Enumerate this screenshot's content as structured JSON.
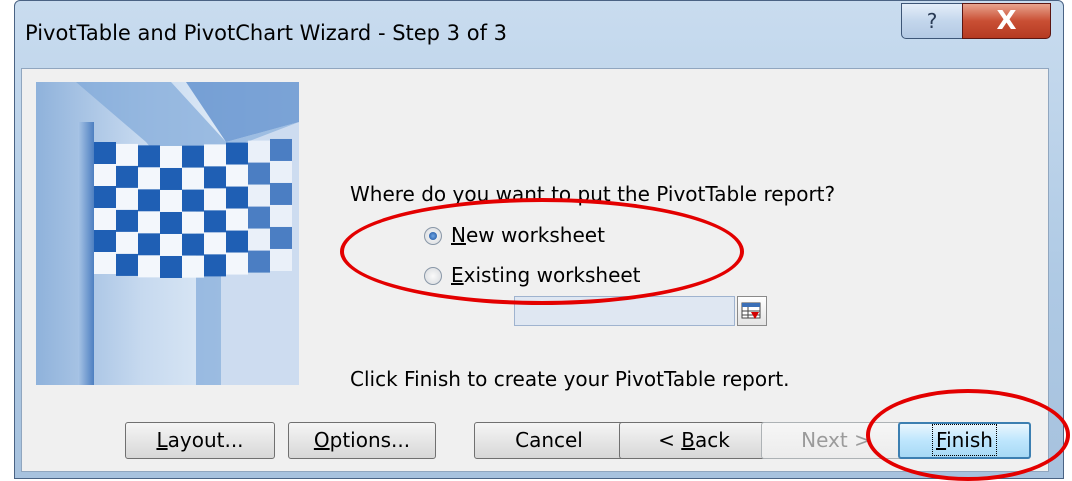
{
  "window": {
    "title": "PivotTable and PivotChart Wizard - Step 3 of 3",
    "help_glyph": "?",
    "close_glyph": "X"
  },
  "content": {
    "question": "Where do you want to put the PivotTable report?",
    "options": [
      {
        "pre": "",
        "accel": "N",
        "post": "ew worksheet",
        "selected": true
      },
      {
        "pre": "",
        "accel": "E",
        "post": "xisting worksheet",
        "selected": false
      }
    ],
    "reference_input_value": "",
    "hint": "Click Finish to create your PivotTable report."
  },
  "buttons": {
    "layout": {
      "pre": "",
      "accel": "L",
      "post": "ayout..."
    },
    "options": {
      "pre": "",
      "accel": "O",
      "post": "ptions..."
    },
    "cancel": {
      "label": "Cancel"
    },
    "back": {
      "pre": "< ",
      "accel": "B",
      "post": "ack"
    },
    "next": {
      "label": "Next >",
      "enabled": false
    },
    "finish": {
      "pre": "",
      "accel": "F",
      "post": "inish"
    }
  },
  "colors": {
    "annotation": "#e30000",
    "window_frame": "#aec9e4",
    "close_button": "#c94f34"
  },
  "icons": {
    "help": "question-mark-icon",
    "close": "close-icon",
    "reference": "collapse-dialog-icon",
    "wizard_art": "checkered-flag-icon"
  }
}
